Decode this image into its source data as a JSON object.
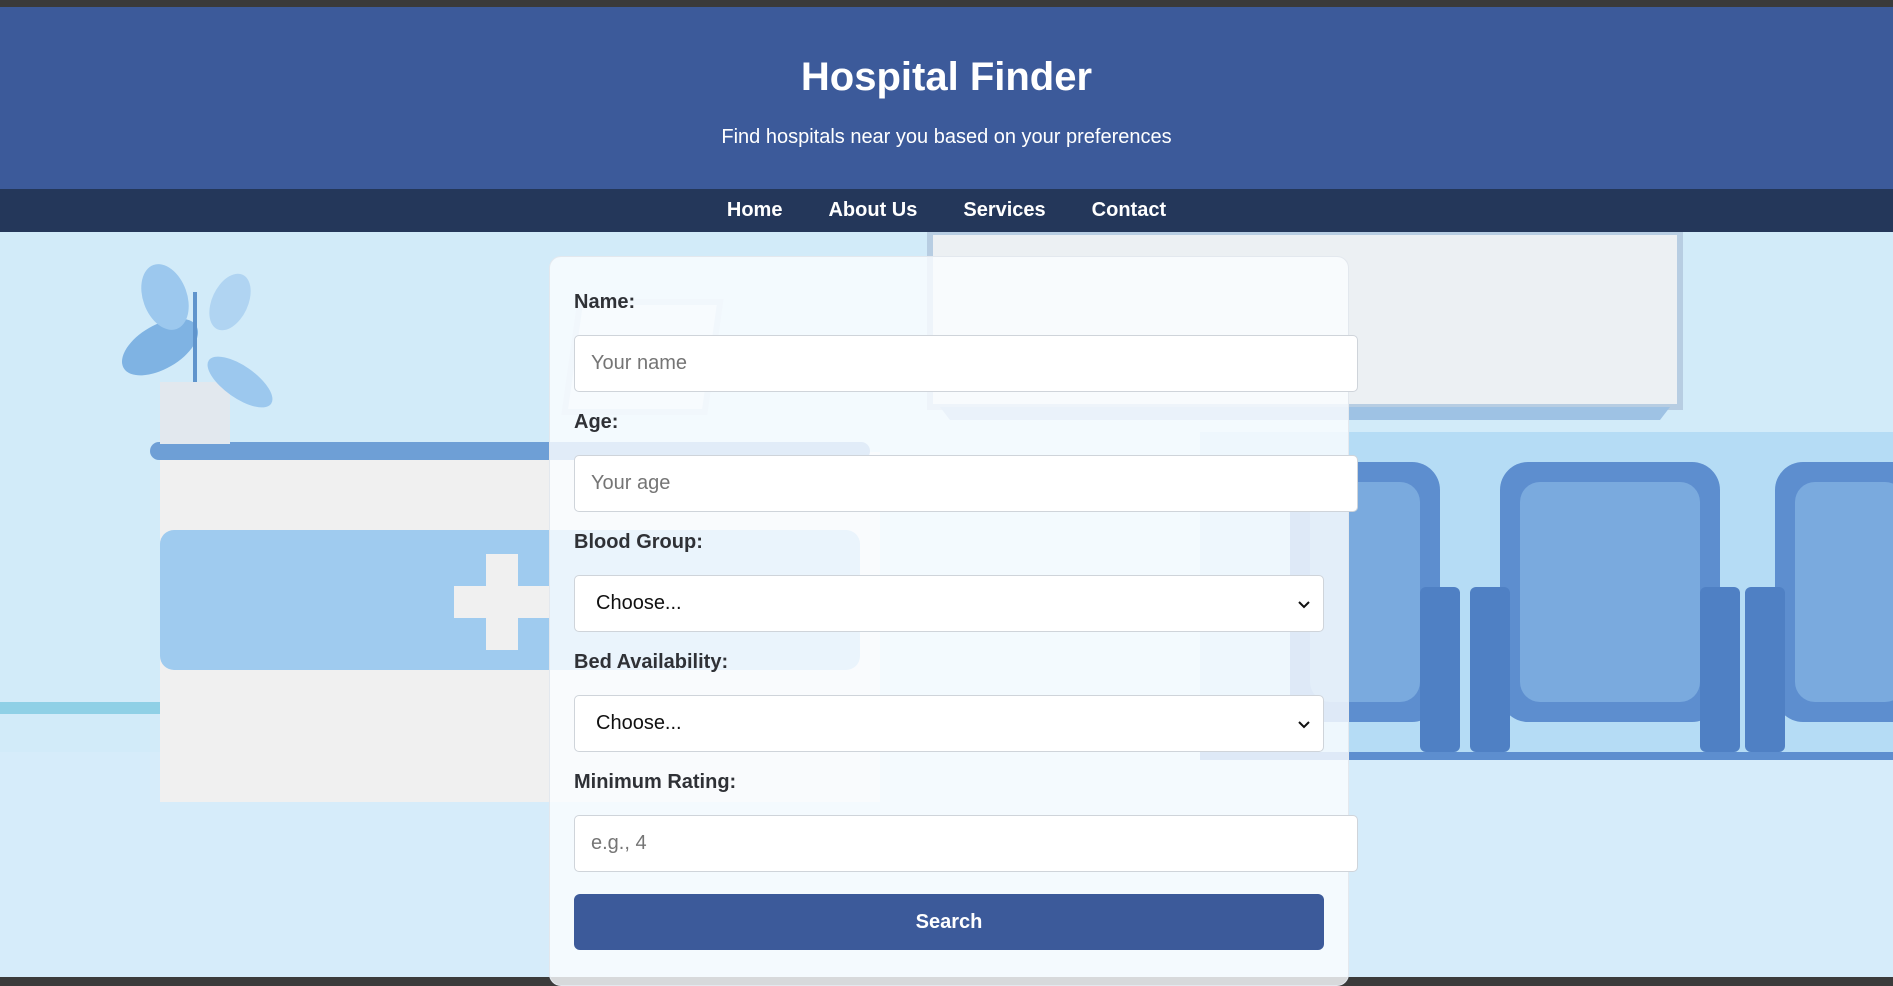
{
  "header": {
    "title": "Hospital Finder",
    "subtitle": "Find hospitals near you based on your preferences"
  },
  "nav": {
    "items": [
      {
        "label": "Home"
      },
      {
        "label": "About Us"
      },
      {
        "label": "Services"
      },
      {
        "label": "Contact"
      }
    ]
  },
  "form": {
    "name": {
      "label": "Name:",
      "placeholder": "Your name",
      "value": ""
    },
    "age": {
      "label": "Age:",
      "placeholder": "Your age",
      "value": ""
    },
    "blood_group": {
      "label": "Blood Group:",
      "selected": "Choose..."
    },
    "bed_availability": {
      "label": "Bed Availability:",
      "selected": "Choose..."
    },
    "min_rating": {
      "label": "Minimum Rating:",
      "placeholder": "e.g., 4",
      "value": ""
    },
    "search_label": "Search"
  },
  "colors": {
    "header_bg": "#3c5a9a",
    "nav_bg": "#24375a",
    "button_bg": "#3c5a9a",
    "background": "#d2ebf9"
  },
  "icons": {
    "select_arrow": "chevron-down-icon"
  }
}
